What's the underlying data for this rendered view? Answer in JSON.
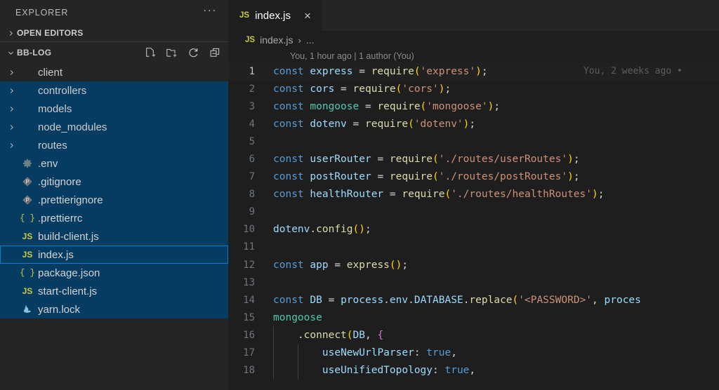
{
  "sidebar": {
    "title": "EXPLORER",
    "more_actions_label": "···",
    "sections": [
      {
        "label": "OPEN EDITORS",
        "expanded": false,
        "chevron": "chevron-right"
      },
      {
        "label": "BB-LOG",
        "expanded": true,
        "chevron": "chevron-down"
      }
    ],
    "bblog_actions": [
      {
        "name": "new-file-icon",
        "title": "New File"
      },
      {
        "name": "new-folder-icon",
        "title": "New Folder"
      },
      {
        "name": "refresh-icon",
        "title": "Refresh Explorer"
      },
      {
        "name": "collapse-all-icon",
        "title": "Collapse Folders in Explorer"
      }
    ],
    "files": [
      {
        "name": "client",
        "type": "folder",
        "icon": "chevron-right",
        "state": "hover"
      },
      {
        "name": "controllers",
        "type": "folder",
        "icon": "chevron-right",
        "state": "selected"
      },
      {
        "name": "models",
        "type": "folder",
        "icon": "chevron-right",
        "state": "selected"
      },
      {
        "name": "node_modules",
        "type": "folder",
        "icon": "chevron-right",
        "state": "selected"
      },
      {
        "name": "routes",
        "type": "folder",
        "icon": "chevron-right",
        "state": "selected"
      },
      {
        "name": ".env",
        "type": "file",
        "icon": "gear-icon",
        "state": "selected"
      },
      {
        "name": ".gitignore",
        "type": "file",
        "icon": "git-icon",
        "state": "selected"
      },
      {
        "name": ".prettierignore",
        "type": "file",
        "icon": "git-icon",
        "state": "selected"
      },
      {
        "name": ".prettierrc",
        "type": "file",
        "icon": "json-icon",
        "state": "selected"
      },
      {
        "name": "build-client.js",
        "type": "file",
        "icon": "js-icon",
        "state": "selected"
      },
      {
        "name": "index.js",
        "type": "file",
        "icon": "js-icon",
        "state": "focused"
      },
      {
        "name": "package.json",
        "type": "file",
        "icon": "json-icon",
        "state": "selected"
      },
      {
        "name": "start-client.js",
        "type": "file",
        "icon": "js-icon",
        "state": "selected"
      },
      {
        "name": "yarn.lock",
        "type": "file",
        "icon": "yarn-icon",
        "state": "selected"
      }
    ]
  },
  "editor": {
    "tab": {
      "label": "index.js",
      "icon": "js-icon",
      "close_label": "×"
    },
    "breadcrumb": {
      "file": "index.js",
      "separator": "›",
      "overflow": "..."
    },
    "blame_header": "You, 1 hour ago | 1 author (You)",
    "inline_blame": "You, 2 weeks ago •",
    "language": "javascript",
    "lines": [
      {
        "n": 1,
        "active": true,
        "text": "const express = require('express');"
      },
      {
        "n": 2,
        "active": false,
        "text": "const cors = require('cors');"
      },
      {
        "n": 3,
        "active": false,
        "text": "const mongoose = require('mongoose');"
      },
      {
        "n": 4,
        "active": false,
        "text": "const dotenv = require('dotenv');"
      },
      {
        "n": 5,
        "active": false,
        "text": ""
      },
      {
        "n": 6,
        "active": false,
        "text": "const userRouter = require('./routes/userRoutes');"
      },
      {
        "n": 7,
        "active": false,
        "text": "const postRouter = require('./routes/postRoutes');"
      },
      {
        "n": 8,
        "active": false,
        "text": "const healthRouter = require('./routes/healthRoutes');"
      },
      {
        "n": 9,
        "active": false,
        "text": ""
      },
      {
        "n": 10,
        "active": false,
        "text": "dotenv.config();"
      },
      {
        "n": 11,
        "active": false,
        "text": ""
      },
      {
        "n": 12,
        "active": false,
        "text": "const app = express();"
      },
      {
        "n": 13,
        "active": false,
        "text": ""
      },
      {
        "n": 14,
        "active": false,
        "text": "const DB = process.env.DATABASE.replace('<PASSWORD>', proces"
      },
      {
        "n": 15,
        "active": false,
        "text": "mongoose"
      },
      {
        "n": 16,
        "active": false,
        "text": "    .connect(DB, {"
      },
      {
        "n": 17,
        "active": false,
        "text": "        useNewUrlParser: true,"
      },
      {
        "n": 18,
        "active": false,
        "text": "        useUnifiedTopology: true,"
      }
    ]
  },
  "colors": {
    "sidebar_bg": "#252526",
    "editor_bg": "#1e1e1e",
    "selection_blue": "#063b62",
    "focus_border": "#007fd4",
    "js_yellow": "#cbcb41",
    "keyword_blue": "#569cd6",
    "string_orange": "#ce9178",
    "function_yellow": "#dcdcaa",
    "variable_blue": "#9cdcfe",
    "type_green": "#4ec9b0",
    "paren_gold": "#ffd700"
  }
}
